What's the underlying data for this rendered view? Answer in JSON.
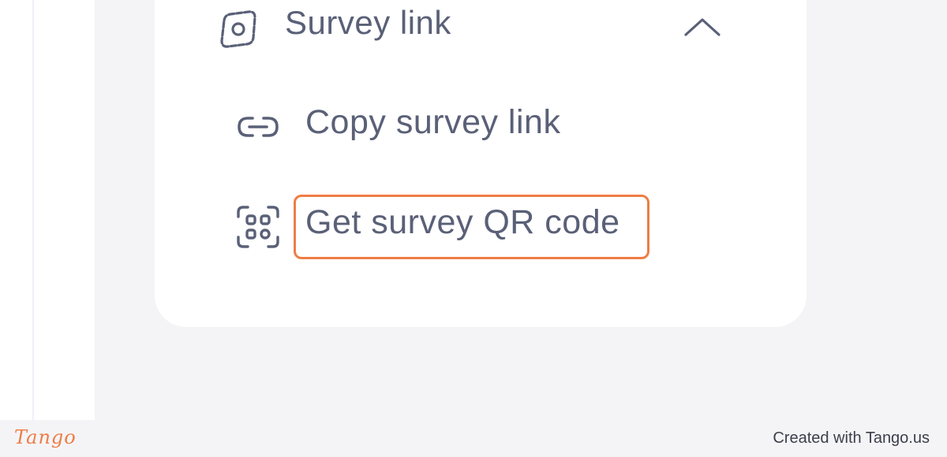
{
  "section": {
    "title": "Survey link",
    "icon": "survey-link-icon",
    "expanded": true
  },
  "menu": {
    "items": [
      {
        "label": "Copy survey link",
        "icon": "link-icon"
      },
      {
        "label": "Get survey QR code",
        "icon": "qr-scan-icon",
        "highlighted": true
      }
    ]
  },
  "footer": {
    "logo": "Tango",
    "credit": "Created with Tango.us"
  },
  "colors": {
    "text": "#5a6077",
    "highlight": "#ee7d45",
    "background": "#f4f4f7",
    "card": "#ffffff"
  }
}
